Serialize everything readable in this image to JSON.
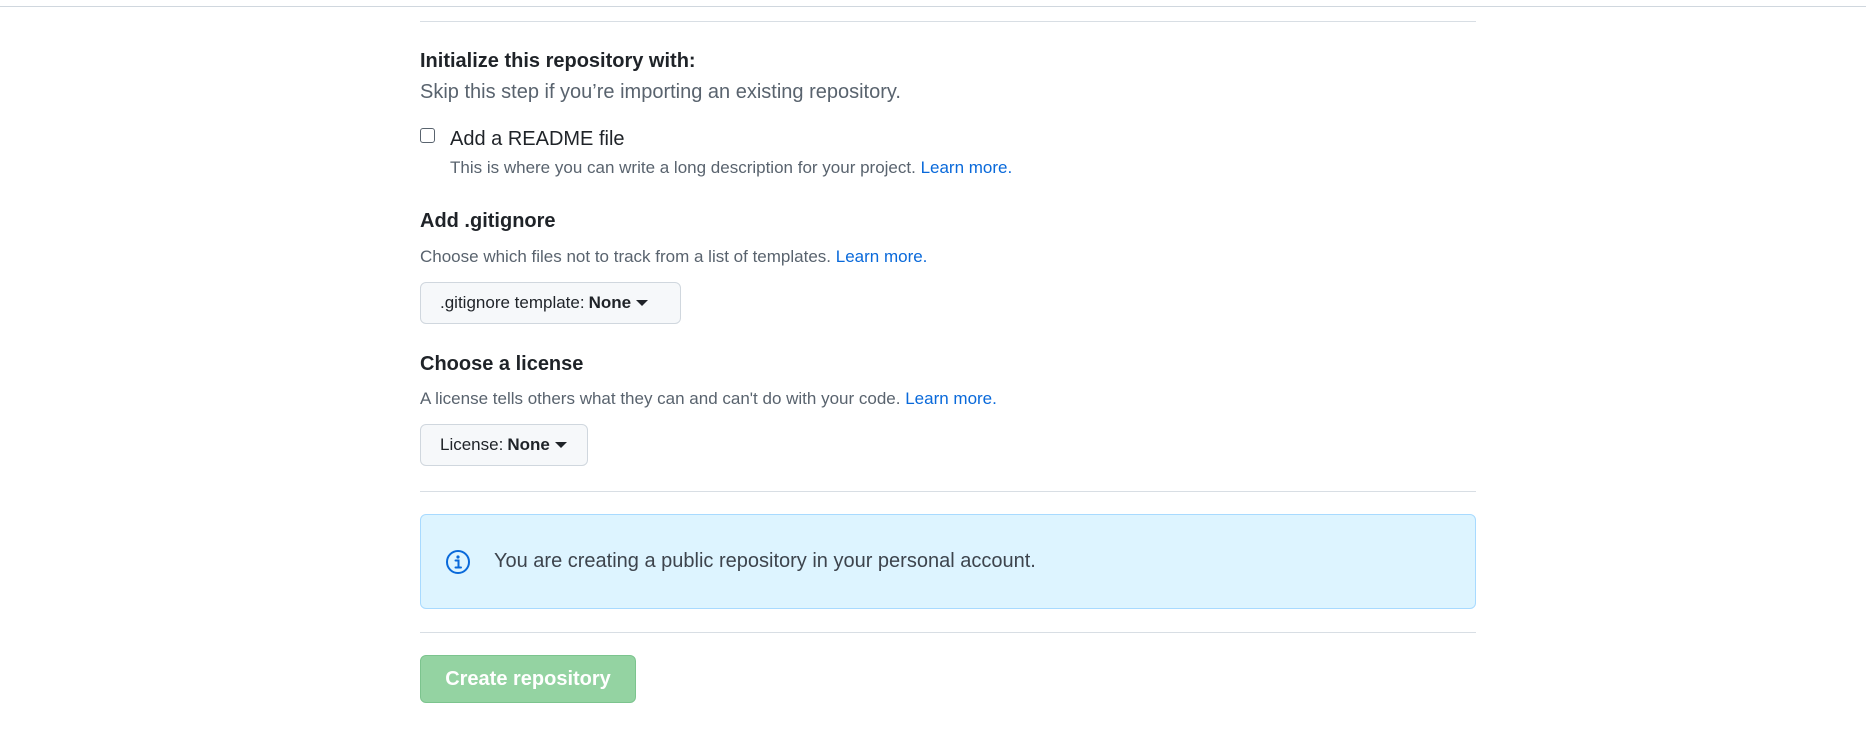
{
  "initialize": {
    "title": "Initialize this repository with:",
    "subtitle": "Skip this step if you’re importing an existing repository."
  },
  "readme": {
    "label": "Add a README file",
    "description": "This is where you can write a long description for your project.",
    "learn_more": "Learn more.",
    "checked": false
  },
  "gitignore": {
    "title": "Add .gitignore",
    "description": "Choose which files not to track from a list of templates.",
    "learn_more": "Learn more.",
    "button_label": ".gitignore template:",
    "button_value": "None"
  },
  "license": {
    "title": "Choose a license",
    "description": "A license tells others what they can and can't do with your code.",
    "learn_more": "Learn more.",
    "button_label": "License:",
    "button_value": "None"
  },
  "notice": {
    "icon": "info-icon",
    "text": "You are creating a public repository in your personal account."
  },
  "create_button": {
    "label": "Create repository",
    "disabled": true
  },
  "colors": {
    "link": "#0969da",
    "notice_bg": "#ddf4ff",
    "create_button_bg": "#94d3a2"
  }
}
